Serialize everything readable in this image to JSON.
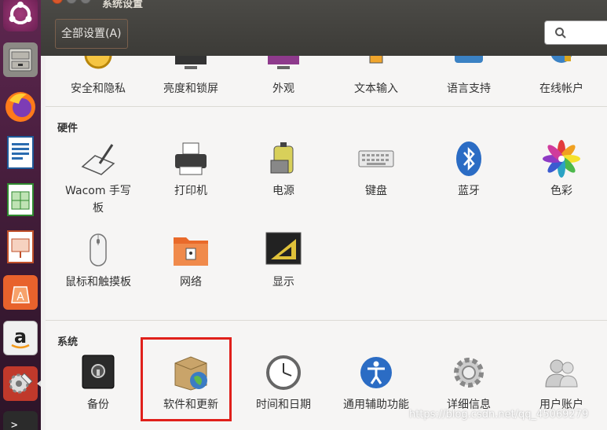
{
  "window": {
    "title": "系统设置"
  },
  "header": {
    "all_settings_label": "全部设置(A)",
    "search_placeholder": ""
  },
  "launcher": {
    "apps": [
      {
        "name": "ubuntu-dash-icon"
      },
      {
        "name": "file-cabinet-icon"
      },
      {
        "name": "firefox-icon"
      },
      {
        "name": "writer-icon"
      },
      {
        "name": "calc-icon"
      },
      {
        "name": "impress-icon"
      },
      {
        "name": "software-center-icon"
      },
      {
        "name": "amazon-icon"
      },
      {
        "name": "system-settings-icon"
      },
      {
        "name": "terminal-icon"
      }
    ]
  },
  "personal": {
    "items": [
      {
        "label": "安全和隐私"
      },
      {
        "label": "亮度和锁屏"
      },
      {
        "label": "外观"
      },
      {
        "label": "文本输入"
      },
      {
        "label": "语言支持"
      },
      {
        "label": "在线帐户"
      }
    ]
  },
  "hardware": {
    "title": "硬件",
    "items": [
      {
        "label": "Wacom 手写\n板"
      },
      {
        "label": "打印机"
      },
      {
        "label": "电源"
      },
      {
        "label": "键盘"
      },
      {
        "label": "蓝牙"
      },
      {
        "label": "色彩"
      },
      {
        "label": "鼠标和触摸板"
      },
      {
        "label": "网络"
      },
      {
        "label": "显示"
      }
    ]
  },
  "system": {
    "title": "系统",
    "items": [
      {
        "label": "备份"
      },
      {
        "label": "软件和更新"
      },
      {
        "label": "时间和日期"
      },
      {
        "label": "通用辅助功能"
      },
      {
        "label": "详细信息"
      },
      {
        "label": "用户账户"
      }
    ]
  },
  "watermark": "https://blog.csdn.net/qq_45069279",
  "colors": {
    "highlight": "#e0201b",
    "titlebar": "#3c3b37",
    "launcher": "#5e2750"
  }
}
